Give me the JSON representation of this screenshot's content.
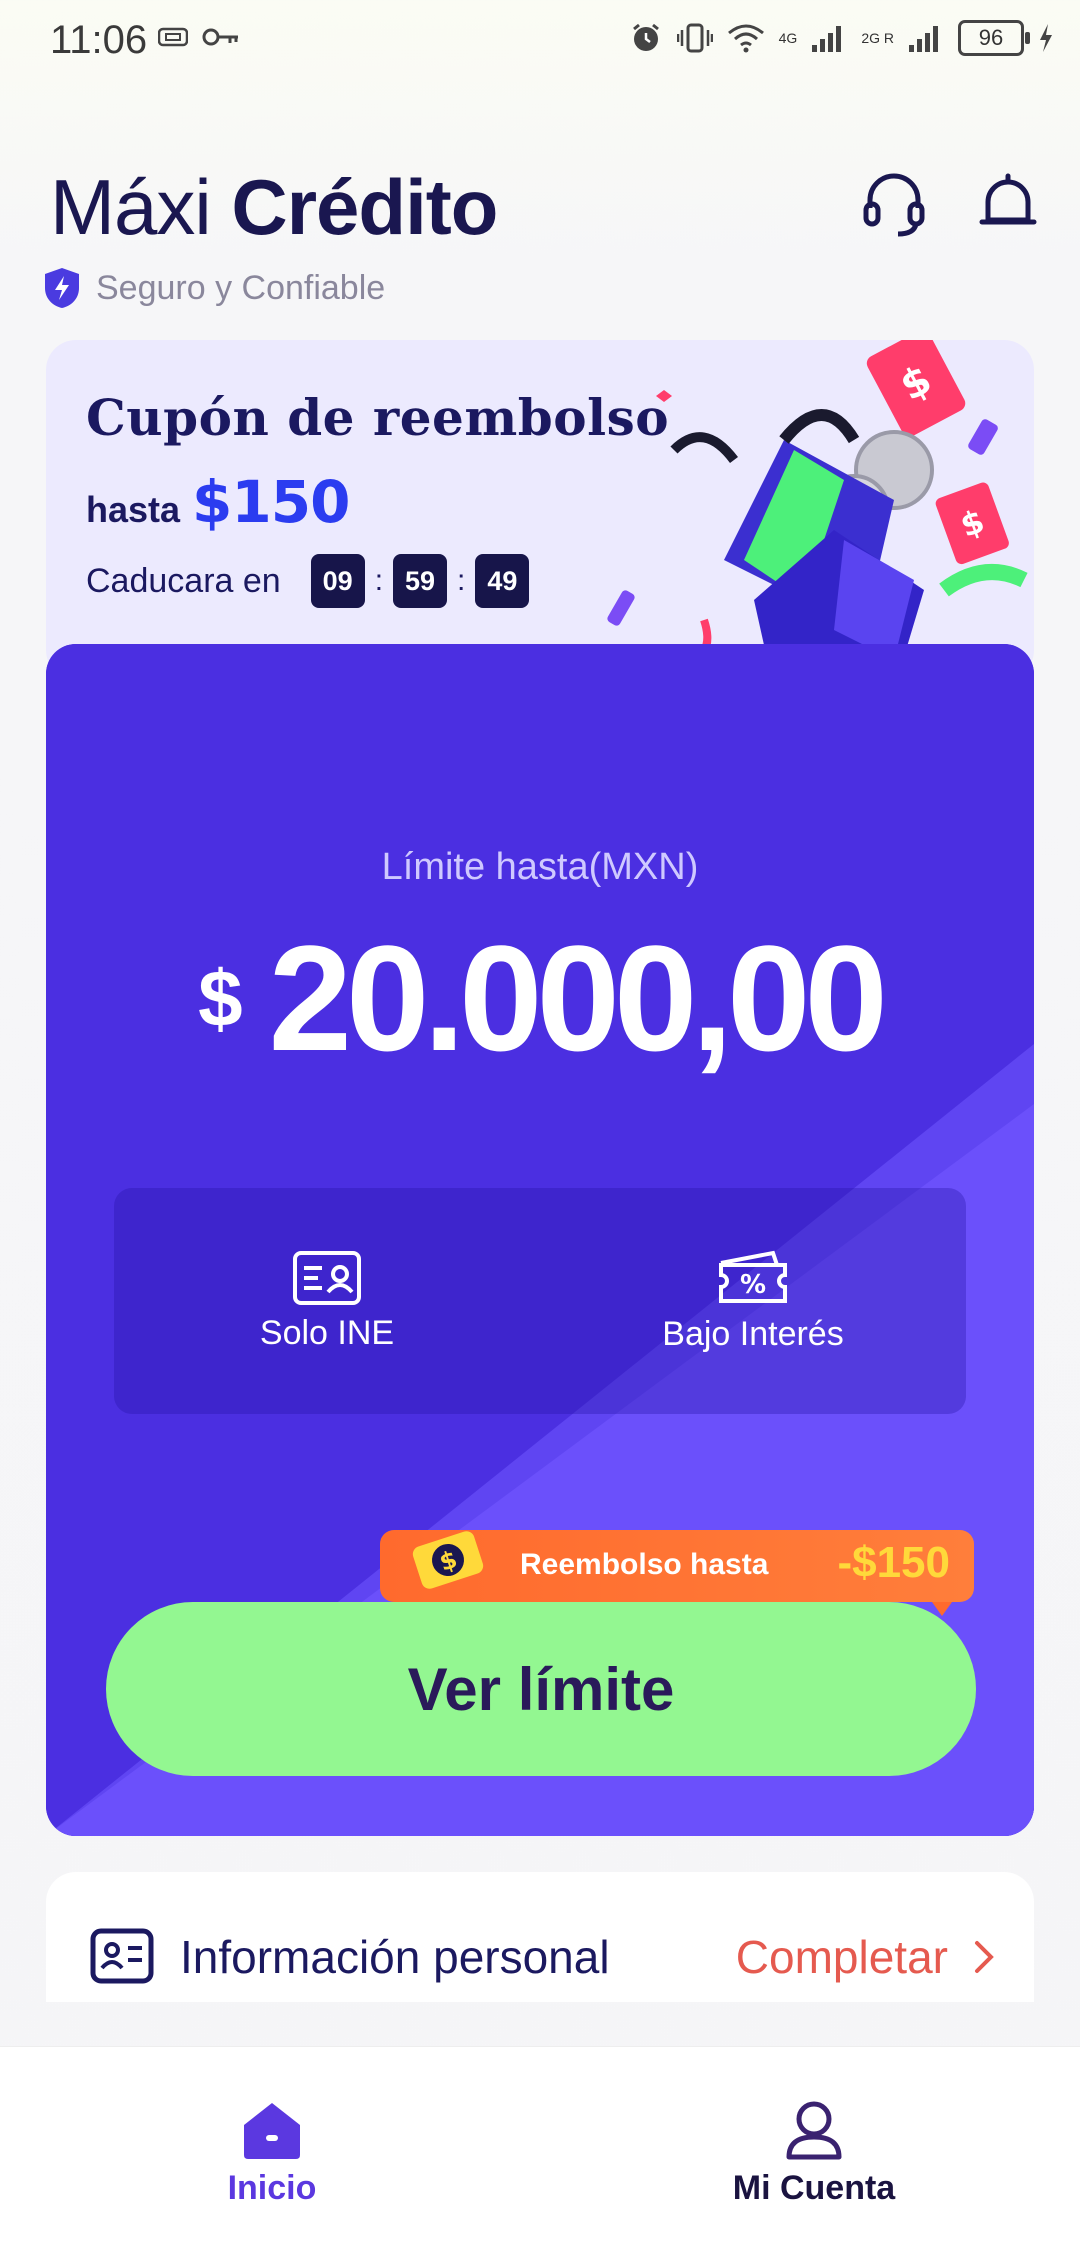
{
  "status_bar": {
    "time": "11:06",
    "battery": "96",
    "net_a": "4G",
    "net_b": "2G R"
  },
  "header": {
    "title_light": "Máxi",
    "title_bold": "Crédito",
    "trust_text": "Seguro y Confiable",
    "support_icon": "headset-icon",
    "notification_icon": "bell-icon"
  },
  "coupon": {
    "title": "Cupón de reembolso",
    "upto_label": "hasta",
    "amount": "$150",
    "expiry_label": "Caducara en",
    "hours": "09",
    "minutes": "59",
    "seconds": "49"
  },
  "credit": {
    "limit_label": "Límite hasta(MXN)",
    "currency": "$",
    "amount": "20.000,00",
    "features": [
      {
        "label": "Solo INE",
        "icon": "id-card-icon"
      },
      {
        "label": "Bajo Interés",
        "icon": "percent-ticket-icon"
      }
    ],
    "rebate_label": "Reembolso hasta",
    "rebate_amount": "-$150",
    "cta_label": "Ver límite"
  },
  "personal_info": {
    "label": "Información personal",
    "action": "Completar"
  },
  "bottom_nav": {
    "items": [
      {
        "label": "Inicio",
        "icon": "home-icon",
        "active": true
      },
      {
        "label": "Mi Cuenta",
        "icon": "user-icon",
        "active": false
      }
    ]
  },
  "colors": {
    "brand_purple": "#4b2fe1",
    "cta_green": "#93f791",
    "accent_orange": "#ff6a2d",
    "complete_red": "#e55a4f"
  }
}
